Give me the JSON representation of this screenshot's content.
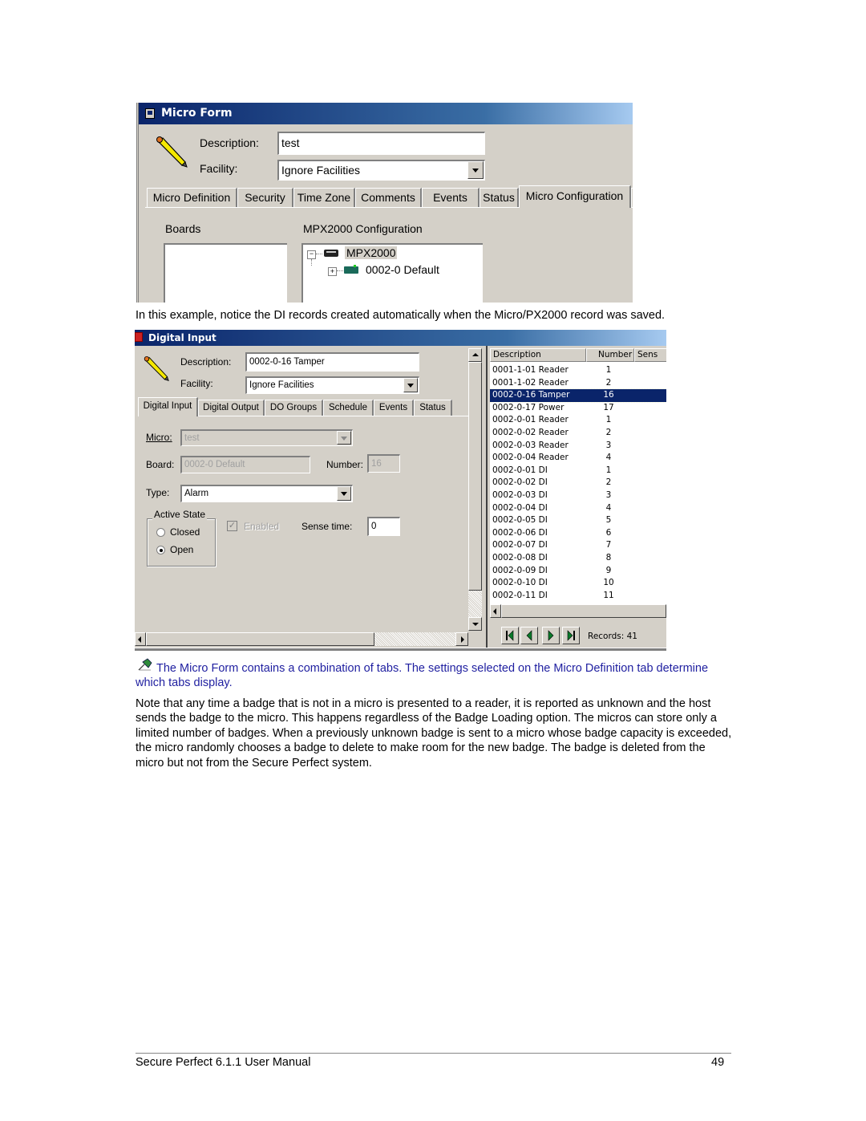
{
  "micro_form": {
    "title": "Micro Form",
    "description_label": "Description:",
    "description_value": "test",
    "facility_label": "Facility:",
    "facility_value": "Ignore Facilities",
    "tabs": [
      {
        "label": "Micro Definition"
      },
      {
        "label": "Security"
      },
      {
        "label": "Time Zone"
      },
      {
        "label": "Comments"
      },
      {
        "label": "Events"
      },
      {
        "label": "Status"
      },
      {
        "label": "Micro Configuration",
        "active": true
      }
    ],
    "boards_label": "Boards",
    "config_label": "MPX2000 Configuration",
    "tree": [
      {
        "label": "MPX2000",
        "expander": "−",
        "level": 0
      },
      {
        "label": "0002-0 Default",
        "expander": "+",
        "level": 1
      }
    ]
  },
  "caption1": "In this example, notice the DI records created automatically when the Micro/PX2000 record was saved.",
  "digital_input": {
    "title": "Digital Input",
    "description_label": "Description:",
    "description_value": "0002-0-16 Tamper",
    "facility_label": "Facility:",
    "facility_value": "Ignore Facilities",
    "tabs": [
      {
        "label": "Digital Input",
        "active": true
      },
      {
        "label": "Digital Output"
      },
      {
        "label": "DO Groups"
      },
      {
        "label": "Schedule"
      },
      {
        "label": "Events"
      },
      {
        "label": "Status"
      }
    ],
    "micro_label": "Micro:",
    "micro_value": "test",
    "board_label": "Board:",
    "board_value": "0002-0 Default",
    "number_label": "Number:",
    "number_value": "16",
    "type_label": "Type:",
    "type_value": "Alarm",
    "active_state_label": "Active State",
    "radio_closed": "Closed",
    "radio_open": "Open",
    "active_state_selected": "Open",
    "enabled_label": "Enabled",
    "enabled_checked": true,
    "sense_time_label": "Sense time:",
    "sense_time_value": "0",
    "grid": {
      "columns": [
        "Description",
        "Number",
        "Sens"
      ],
      "rows": [
        {
          "description": "0001-1-01 Reader",
          "number": "1"
        },
        {
          "description": "0001-1-02 Reader",
          "number": "2"
        },
        {
          "description": "0002-0-16 Tamper",
          "number": "16",
          "selected": true
        },
        {
          "description": "0002-0-17 Power",
          "number": "17"
        },
        {
          "description": "0002-0-01 Reader",
          "number": "1"
        },
        {
          "description": "0002-0-02 Reader",
          "number": "2"
        },
        {
          "description": "0002-0-03 Reader",
          "number": "3"
        },
        {
          "description": "0002-0-04 Reader",
          "number": "4"
        },
        {
          "description": "0002-0-01 DI",
          "number": "1"
        },
        {
          "description": "0002-0-02 DI",
          "number": "2"
        },
        {
          "description": "0002-0-03 DI",
          "number": "3"
        },
        {
          "description": "0002-0-04 DI",
          "number": "4"
        },
        {
          "description": "0002-0-05 DI",
          "number": "5"
        },
        {
          "description": "0002-0-06 DI",
          "number": "6"
        },
        {
          "description": "0002-0-07 DI",
          "number": "7"
        },
        {
          "description": "0002-0-08 DI",
          "number": "8"
        },
        {
          "description": "0002-0-09 DI",
          "number": "9"
        },
        {
          "description": "0002-0-10 DI",
          "number": "10"
        },
        {
          "description": "0002-0-11 DI",
          "number": "11"
        }
      ]
    },
    "records_label": "Records: 41"
  },
  "note": {
    "icon": "pushpin-icon",
    "text": "The Micro Form contains a combination of tabs. The settings selected on the Micro Definition tab determine which tabs display.",
    "color": "#1f1fa0"
  },
  "paragraph": "Note that any time a badge that is not in a micro is presented to a reader, it is reported as unknown and the host sends the badge to the micro. This happens regardless of the Badge Loading option. The micros can store only a limited number of badges. When a previously unknown badge is sent to a micro whose badge capacity is exceeded, the micro randomly chooses a badge to delete to make room for the new badge. The badge is deleted from the micro but not from the Secure Perfect system.",
  "footer": {
    "left": "Secure Perfect 6.1.1 User Manual",
    "page": "49"
  }
}
